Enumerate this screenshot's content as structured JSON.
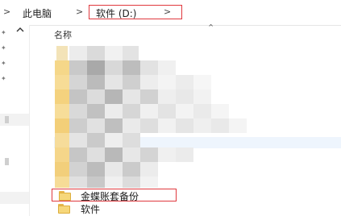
{
  "breadcrumb": {
    "separator": ">",
    "items": [
      "此电脑"
    ],
    "current": "软件 (D:)"
  },
  "columns": {
    "name_header": "名称"
  },
  "files": [
    {
      "name": "金蝶账套备份",
      "type": "folder",
      "highlighted": true
    },
    {
      "name": "软件",
      "type": "folder",
      "highlighted": false
    }
  ],
  "colors": {
    "highlight_border": "#e0393e",
    "folder": "#f6d77a",
    "hover_row": "#eef5fd"
  }
}
